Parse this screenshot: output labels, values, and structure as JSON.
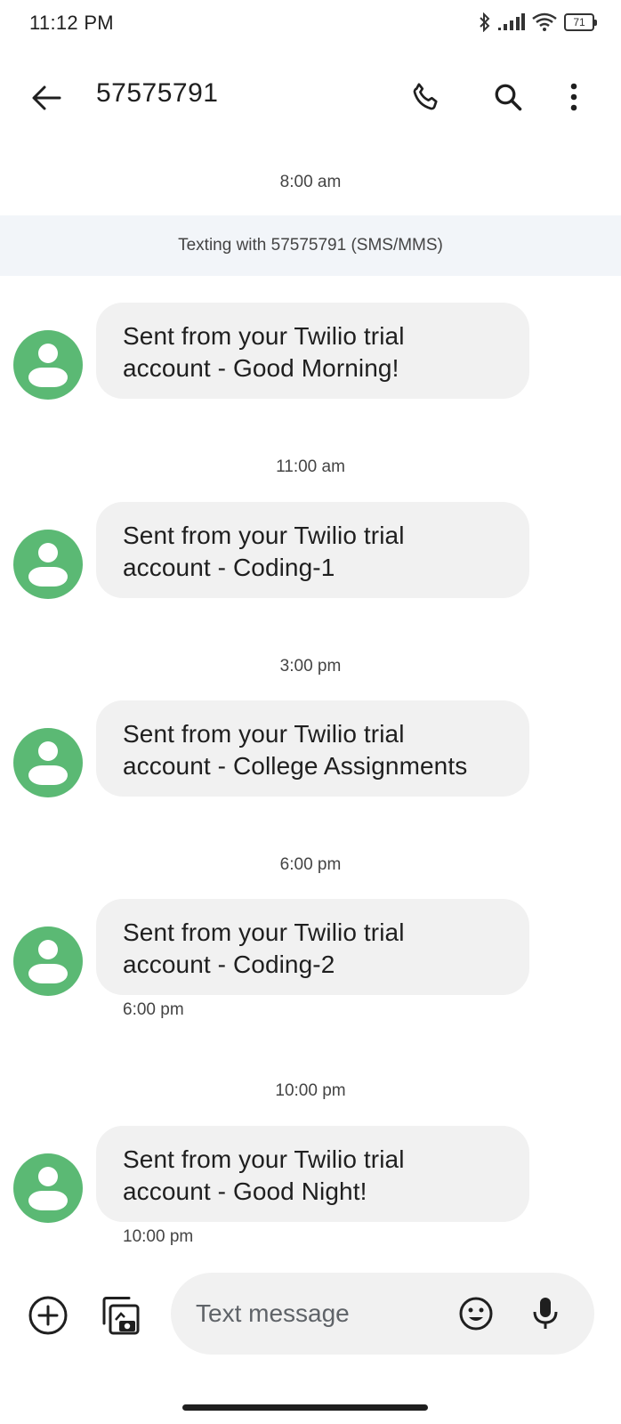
{
  "status_bar": {
    "time": "11:12 PM",
    "battery": "71",
    "icons": [
      "bluetooth-icon",
      "signal-icon",
      "wifi-icon",
      "battery-icon"
    ]
  },
  "header": {
    "title": "57575791",
    "icons": [
      "back-arrow-icon",
      "phone-icon",
      "search-icon",
      "more-vert-icon"
    ]
  },
  "conversation": {
    "banner": "Texting with 57575791 (SMS/MMS)",
    "timestamps": [
      "8:00 am",
      "11:00 am",
      "3:00 pm",
      "6:00 pm",
      "10:00 pm"
    ],
    "messages": [
      {
        "line1": "Sent from your Twilio trial",
        "line2": "account - Good Morning!",
        "time": ""
      },
      {
        "line1": "Sent from your Twilio trial",
        "line2": "account - Coding-1",
        "time": ""
      },
      {
        "line1": "Sent from your Twilio trial",
        "line2": "account - College Assignments",
        "time": ""
      },
      {
        "line1": "Sent from your Twilio trial",
        "line2": "account - Coding-2",
        "time": "6:00 pm"
      },
      {
        "line1": "Sent from your Twilio trial",
        "line2": "account - Good Night!",
        "time": "10:00 pm"
      }
    ]
  },
  "compose": {
    "placeholder": "Text message",
    "icons": [
      "add-circle-icon",
      "gallery-icon",
      "emoji-icon",
      "mic-icon"
    ]
  },
  "colors": {
    "avatar": "#5bb974",
    "bubble": "#f1f1f1",
    "banner": "#f2f5f9"
  }
}
